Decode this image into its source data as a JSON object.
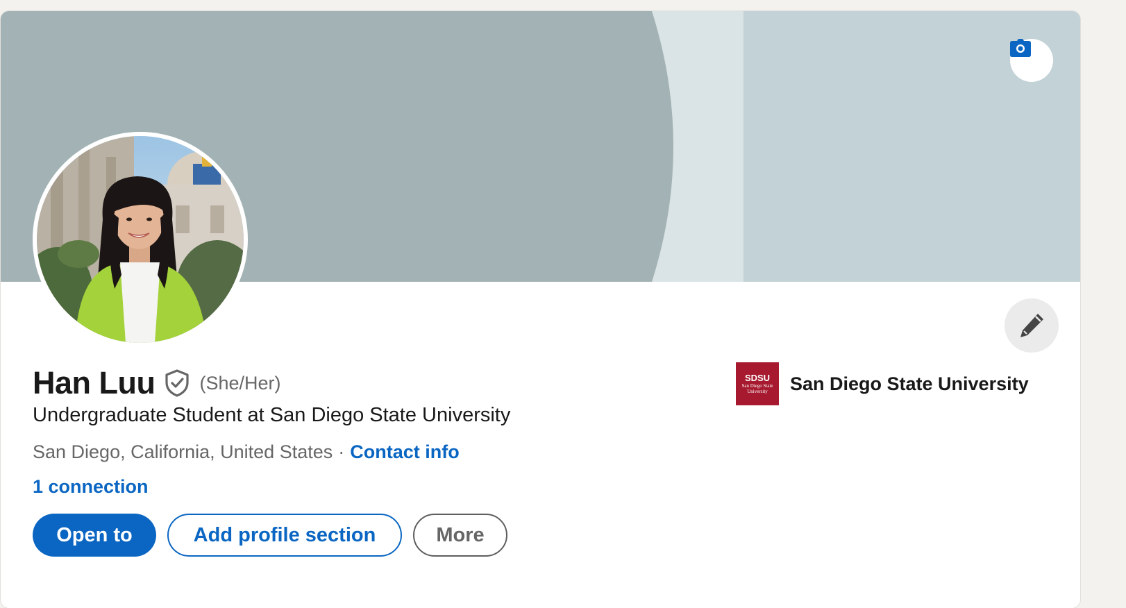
{
  "profile": {
    "name": "Han Luu",
    "pronouns": "(She/Her)",
    "headline": "Undergraduate Student at San Diego State University",
    "location": "San Diego, California, United States",
    "separator": "·",
    "contact_info_label": "Contact info",
    "connections_label": "1 connection"
  },
  "education": {
    "school_name": "San Diego State University",
    "logo_abbr": "SDSU",
    "logo_line1": "San Diego State",
    "logo_line2": "University"
  },
  "actions": {
    "open_to_label": "Open to",
    "add_section_label": "Add profile section",
    "more_label": "More"
  },
  "icons": {
    "camera": "camera-icon",
    "edit": "pencil-icon",
    "verified": "verified-shield-icon"
  },
  "colors": {
    "accent": "#0a66c2",
    "banner_dark": "#a3b3b5",
    "banner_light": "#c2d2d6",
    "sdsu_red": "#a6192e"
  }
}
